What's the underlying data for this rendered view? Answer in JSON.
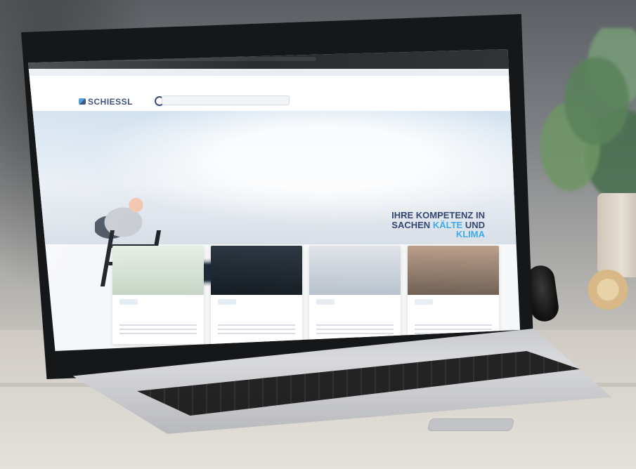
{
  "hero": {
    "headline_part1": "IHRE KOMPETENZ IN",
    "headline_part2": "SACHEN",
    "headline_accent": "KÄLTE",
    "headline_part3": "UND",
    "headline_accent2": "KLIMA"
  },
  "site": {
    "logo_text": "SCHIESSL"
  }
}
